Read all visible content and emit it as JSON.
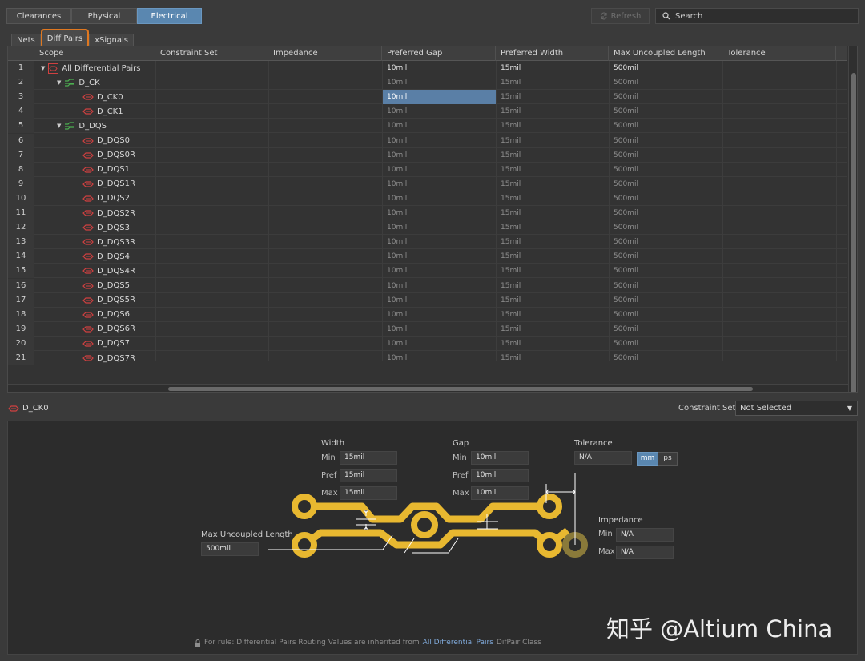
{
  "top_tabs": [
    "Clearances",
    "Physical",
    "Electrical"
  ],
  "refresh_label": "Refresh",
  "search_placeholder": "Search",
  "sub_tabs": [
    "Nets",
    "Diff Pairs",
    "xSignals"
  ],
  "columns": [
    "Scope",
    "Constraint Set",
    "Impedance",
    "Preferred Gap",
    "Preferred Width",
    "Max Uncoupled Length",
    "Tolerance"
  ],
  "rows": [
    {
      "n": "1",
      "name": "All Differential Pairs",
      "gap": "10mil",
      "width": "15mil",
      "len": "500mil"
    },
    {
      "n": "2",
      "name": "D_CK",
      "gap": "10mil",
      "width": "15mil",
      "len": "500mil"
    },
    {
      "n": "3",
      "name": "D_CK0",
      "gap": "10mil",
      "width": "15mil",
      "len": "500mil"
    },
    {
      "n": "4",
      "name": "D_CK1",
      "gap": "10mil",
      "width": "15mil",
      "len": "500mil"
    },
    {
      "n": "5",
      "name": "D_DQS",
      "gap": "10mil",
      "width": "15mil",
      "len": "500mil"
    },
    {
      "n": "6",
      "name": "D_DQS0",
      "gap": "10mil",
      "width": "15mil",
      "len": "500mil"
    },
    {
      "n": "7",
      "name": "D_DQS0R",
      "gap": "10mil",
      "width": "15mil",
      "len": "500mil"
    },
    {
      "n": "8",
      "name": "D_DQS1",
      "gap": "10mil",
      "width": "15mil",
      "len": "500mil"
    },
    {
      "n": "9",
      "name": "D_DQS1R",
      "gap": "10mil",
      "width": "15mil",
      "len": "500mil"
    },
    {
      "n": "10",
      "name": "D_DQS2",
      "gap": "10mil",
      "width": "15mil",
      "len": "500mil"
    },
    {
      "n": "11",
      "name": "D_DQS2R",
      "gap": "10mil",
      "width": "15mil",
      "len": "500mil"
    },
    {
      "n": "12",
      "name": "D_DQS3",
      "gap": "10mil",
      "width": "15mil",
      "len": "500mil"
    },
    {
      "n": "13",
      "name": "D_DQS3R",
      "gap": "10mil",
      "width": "15mil",
      "len": "500mil"
    },
    {
      "n": "14",
      "name": "D_DQS4",
      "gap": "10mil",
      "width": "15mil",
      "len": "500mil"
    },
    {
      "n": "15",
      "name": "D_DQS4R",
      "gap": "10mil",
      "width": "15mil",
      "len": "500mil"
    },
    {
      "n": "16",
      "name": "D_DQS5",
      "gap": "10mil",
      "width": "15mil",
      "len": "500mil"
    },
    {
      "n": "17",
      "name": "D_DQS5R",
      "gap": "10mil",
      "width": "15mil",
      "len": "500mil"
    },
    {
      "n": "18",
      "name": "D_DQS6",
      "gap": "10mil",
      "width": "15mil",
      "len": "500mil"
    },
    {
      "n": "19",
      "name": "D_DQS6R",
      "gap": "10mil",
      "width": "15mil",
      "len": "500mil"
    },
    {
      "n": "20",
      "name": "D_DQS7",
      "gap": "10mil",
      "width": "15mil",
      "len": "500mil"
    },
    {
      "n": "21",
      "name": "D_DQS7R",
      "gap": "10mil",
      "width": "15mil",
      "len": "500mil"
    }
  ],
  "selected_item": "D_CK0",
  "constraint_set_label": "Constraint Set",
  "constraint_set_value": "Not Selected",
  "diagram": {
    "width_title": "Width",
    "gap_title": "Gap",
    "tolerance_title": "Tolerance",
    "impedance_title": "Impedance",
    "min": "Min",
    "pref": "Pref",
    "max": "Max",
    "width_min": "15mil",
    "width_pref": "15mil",
    "width_max": "15mil",
    "gap_min": "10mil",
    "gap_pref": "10mil",
    "gap_max": "10mil",
    "tolerance": "N/A",
    "unit_mm": "mm",
    "unit_ps": "ps",
    "imp_min": "N/A",
    "imp_max": "N/A",
    "max_uncoupled_title": "Max Uncoupled Length",
    "max_uncoupled": "500mil"
  },
  "footer": {
    "prefix": "For rule: Differential Pairs Routing  Values are inherited from",
    "link": "All Differential Pairs",
    "suffix": "DifPair Class"
  },
  "watermark": "知乎 @Altium China",
  "colors": {
    "accent": "#5a87b0",
    "highlight": "#e07820",
    "trace": "#e8b830",
    "net": "#d04040",
    "class": "#4caf50"
  }
}
